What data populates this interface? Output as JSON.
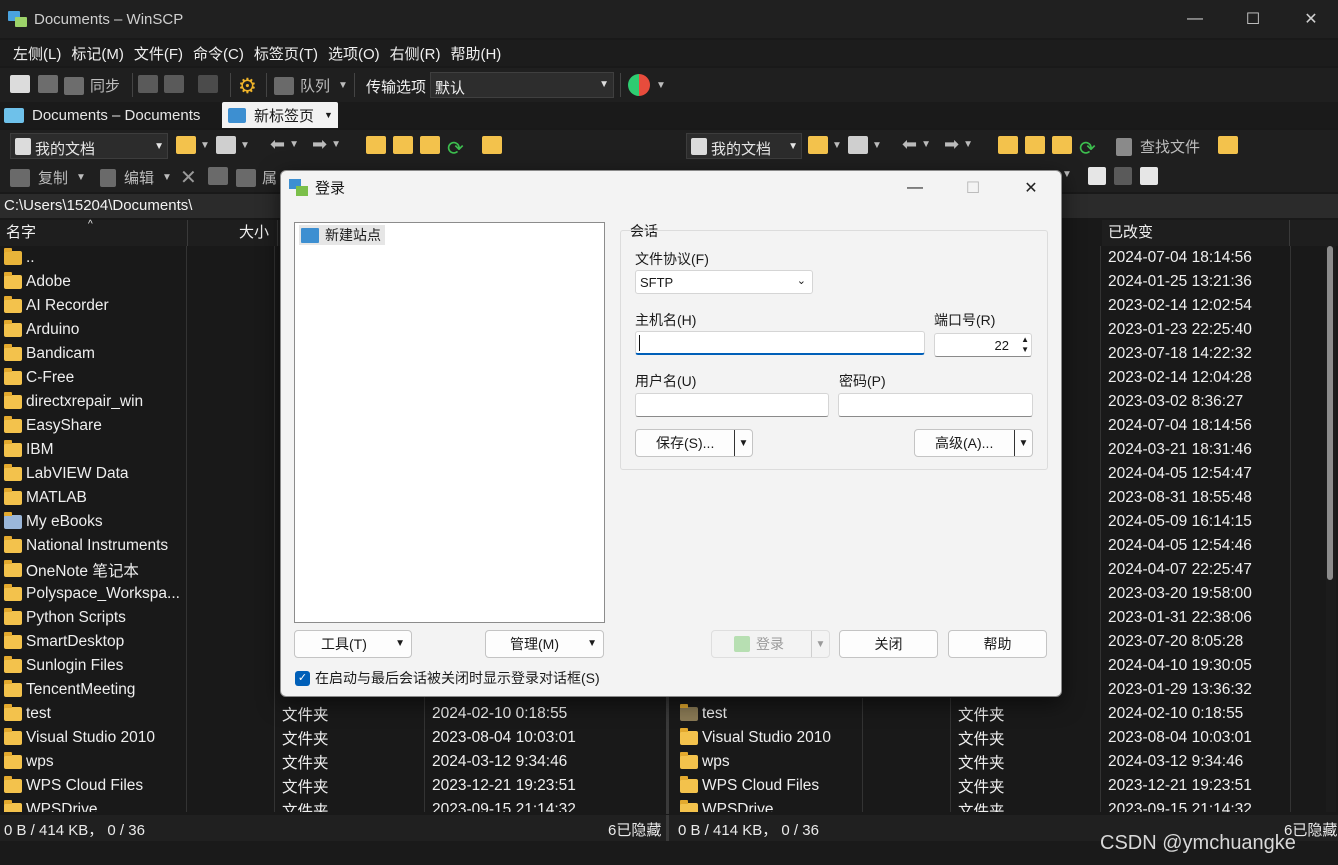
{
  "window": {
    "title": "Documents – WinSCP"
  },
  "menu": [
    "左侧(L)",
    "标记(M)",
    "文件(F)",
    "命令(C)",
    "标签页(T)",
    "选项(O)",
    "右侧(R)",
    "帮助(H)"
  ],
  "toolbar": {
    "sync_label": "同步",
    "queue_label": "队列",
    "transfer_label": "传输选项",
    "transfer_value": "默认"
  },
  "tabs": [
    {
      "label": "Documents – Documents"
    },
    {
      "label": "新标签页"
    }
  ],
  "pathbar": {
    "left_location": "我的文档",
    "right_location": "我的文档",
    "find_files": "查找文件"
  },
  "toolbar2": {
    "copy_label": "复制",
    "edit_label": "编辑",
    "props_label": "属"
  },
  "current_path": "C:\\Users\\15204\\Documents\\",
  "left_panel": {
    "columns": {
      "name": "名字",
      "size": "大小"
    },
    "items": [
      {
        "name": ".."
      },
      {
        "name": "Adobe"
      },
      {
        "name": "AI Recorder"
      },
      {
        "name": "Arduino"
      },
      {
        "name": "Bandicam"
      },
      {
        "name": "C-Free"
      },
      {
        "name": "directxrepair_win"
      },
      {
        "name": "EasyShare"
      },
      {
        "name": "IBM"
      },
      {
        "name": "LabVIEW Data"
      },
      {
        "name": "MATLAB"
      },
      {
        "name": "My eBooks"
      },
      {
        "name": "National Instruments"
      },
      {
        "name": "OneNote 笔记本"
      },
      {
        "name": "Polyspace_Workspa..."
      },
      {
        "name": "Python Scripts"
      },
      {
        "name": "SmartDesktop"
      },
      {
        "name": "Sunlogin Files"
      },
      {
        "name": "TencentMeeting"
      },
      {
        "name": "test",
        "type": "文件夹",
        "changed": "2024-02-10 0:18:55"
      },
      {
        "name": "Visual Studio 2010",
        "type": "文件夹",
        "changed": "2023-08-04 10:03:01"
      },
      {
        "name": "wps",
        "type": "文件夹",
        "changed": "2024-03-12 9:34:46"
      },
      {
        "name": "WPS Cloud Files",
        "type": "文件夹",
        "changed": "2023-12-21 19:23:51"
      },
      {
        "name": "WPSDrive",
        "type": "文件夹",
        "changed": "2023-09-15 21:14:32"
      }
    ]
  },
  "right_panel": {
    "columns": {
      "changed": "已改变"
    },
    "changed_dates": [
      "2024-07-04 18:14:56",
      "2024-01-25 13:21:36",
      "2023-02-14 12:02:54",
      "2023-01-23 22:25:40",
      "2023-07-18 14:22:32",
      "2023-02-14 12:04:28",
      "2023-03-02 8:36:27",
      "2024-07-04 18:14:56",
      "2024-03-21 18:31:46",
      "2024-04-05 12:54:47",
      "2023-08-31 18:55:48",
      "2024-05-09 16:14:15",
      "2024-04-05 12:54:46",
      "2024-04-07 22:25:47",
      "2023-03-20 19:58:00",
      "2023-01-31 22:38:06",
      "2023-07-20 8:05:28",
      "2024-04-10 19:30:05",
      "2023-01-29 13:36:32",
      "2024-02-10 0:18:55",
      "2023-08-04 10:03:01",
      "2024-03-12 9:34:46",
      "2023-12-21 19:23:51",
      "2023-09-15 21:14:32"
    ],
    "visible_items": [
      {
        "name": "test",
        "type": "文件夹"
      },
      {
        "name": "Visual Studio 2010",
        "type": "文件夹"
      },
      {
        "name": "wps",
        "type": "文件夹"
      },
      {
        "name": "WPS Cloud Files",
        "type": "文件夹"
      },
      {
        "name": "WPSDrive",
        "type": "文件夹"
      }
    ]
  },
  "status": {
    "left": "0 B / 414 KB，  0 / 36",
    "left_hidden": "6已隐藏",
    "right": "0 B / 414 KB，  0 / 36",
    "right_hidden": "6已隐藏"
  },
  "watermark": "CSDN @ymchuangke",
  "dialog": {
    "title": "登录",
    "new_site": "新建站点",
    "session_group": "会话",
    "protocol_label": "文件协议(F)",
    "protocol_value": "SFTP",
    "host_label": "主机名(H)",
    "host_value": "",
    "port_label": "端口号(R)",
    "port_value": "22",
    "user_label": "用户名(U)",
    "user_value": "",
    "password_label": "密码(P)",
    "password_value": "",
    "save_button": "保存(S)...",
    "advanced_button": "高级(A)...",
    "tools_button": "工具(T)",
    "manage_button": "管理(M)",
    "login_button": "登录",
    "close_button": "关闭",
    "help_button": "帮助",
    "show_dialog_checkbox": "在启动与最后会话被关闭时显示登录对话框(S)",
    "show_dialog_checked": true
  }
}
